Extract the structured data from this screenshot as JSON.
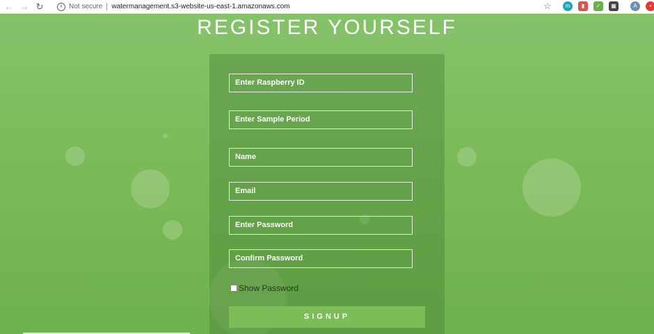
{
  "browser": {
    "security_label": "Not secure",
    "url": "watermanagement.s3-website-us-east-1.amazonaws.com",
    "icons": [
      "back-icon",
      "forward-icon",
      "reload-icon",
      "info-icon",
      "star-icon",
      "extension-m-icon",
      "pdf-icon",
      "download-icon",
      "qr-icon",
      "profile-icon"
    ],
    "profile_initial": "A",
    "ext_m_initial": "m"
  },
  "page": {
    "title": "REGISTER YOURSELF",
    "fields": [
      {
        "placeholder": "Enter Raspberry ID"
      },
      {
        "placeholder": "Enter Sample Period"
      },
      {
        "placeholder": "Name"
      },
      {
        "placeholder": "Email"
      },
      {
        "placeholder": "Enter Password"
      },
      {
        "placeholder": "Confirm Password"
      }
    ],
    "show_password_label": "Show Password",
    "signup_label": "SIGNUP"
  },
  "colors": {
    "background": "#7dbd5a",
    "button": "#7cbd57"
  }
}
